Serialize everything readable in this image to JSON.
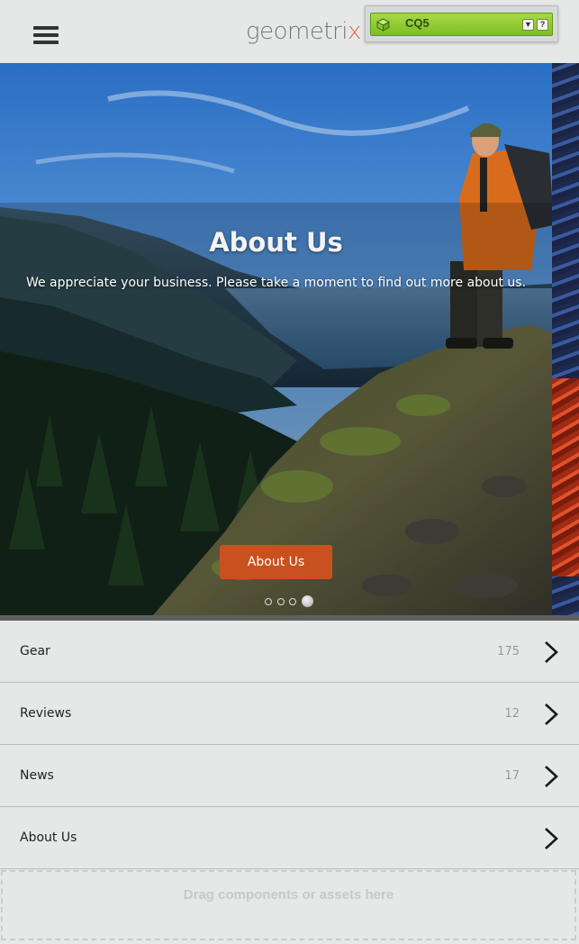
{
  "header": {
    "menu_icon": "hamburger-menu-icon",
    "logo_text": "geometri",
    "logo_x": "x"
  },
  "sidekick": {
    "icon": "cube-icon",
    "label": "CQ5",
    "dropdown_icon": "▼",
    "help_icon": "?",
    "accent_color": "#8cc63f"
  },
  "hero": {
    "title": "About Us",
    "text": "We appreciate your business. Please take a moment to find out more about us.",
    "button_label": "About Us",
    "button_color": "#c9501f",
    "slide_count": 4,
    "active_slide": 4
  },
  "list": {
    "items": [
      {
        "label": "Gear",
        "count": "175"
      },
      {
        "label": "Reviews",
        "count": "12"
      },
      {
        "label": "News",
        "count": "17"
      },
      {
        "label": "About Us",
        "count": ""
      }
    ]
  },
  "dropzone": {
    "message": "Drag components or assets here"
  }
}
